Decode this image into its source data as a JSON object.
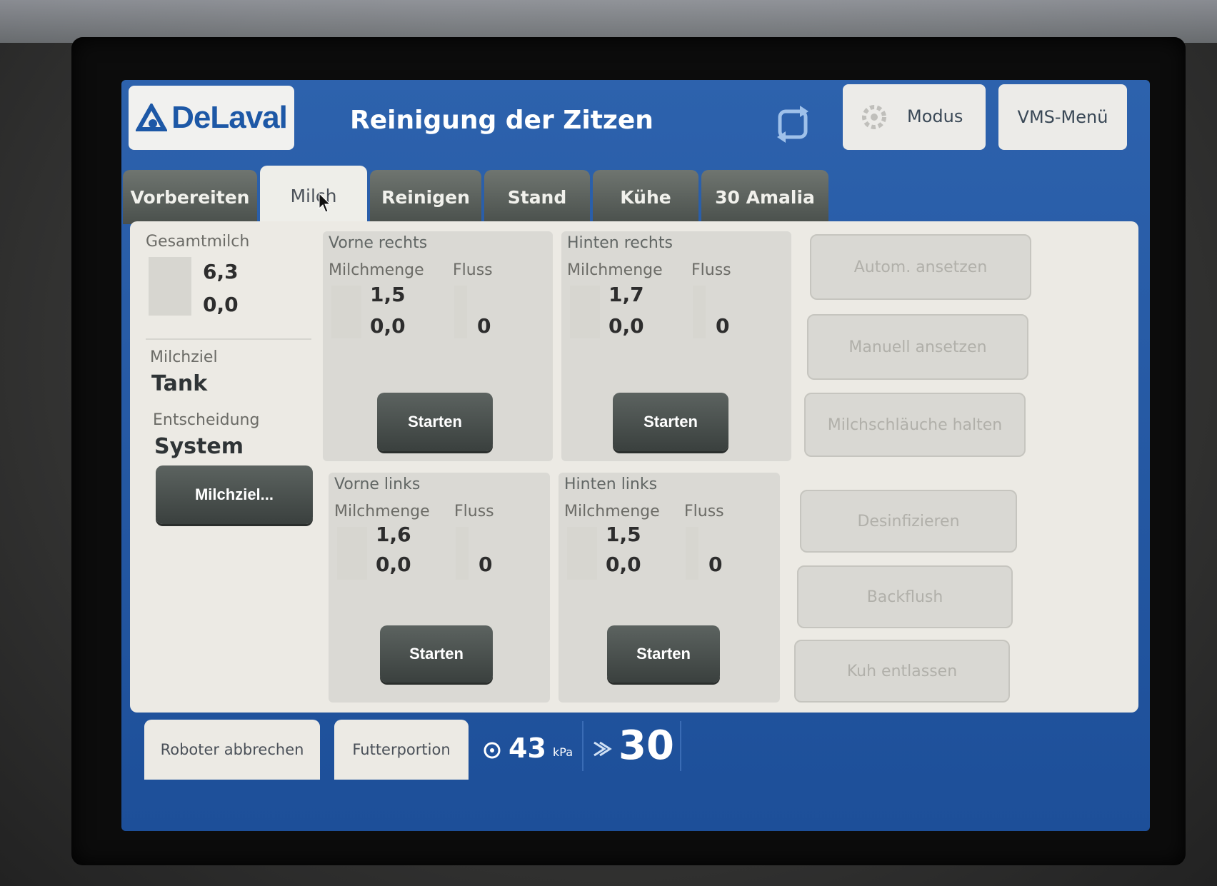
{
  "header": {
    "logo": "DeLaval",
    "title": "Reinigung der Zitzen",
    "modus_label": "Modus",
    "vms_menu_label": "VMS-Menü"
  },
  "tabs": [
    {
      "label": "Vorbereiten"
    },
    {
      "label": "Milch",
      "active": true
    },
    {
      "label": "Reinigen"
    },
    {
      "label": "Stand"
    },
    {
      "label": "Kühe"
    },
    {
      "label": "30 Amalia"
    }
  ],
  "left": {
    "gesamtmilch_label": "Gesamtmilch",
    "gesamtmilch_value1": "6,3",
    "gesamtmilch_value2": "0,0",
    "milchziel_label": "Milchziel",
    "milchziel_value": "Tank",
    "entscheidung_label": "Entscheidung",
    "entscheidung_value": "System",
    "milchziel_button": "Milchziel..."
  },
  "quarters": [
    {
      "title": "Vorne rechts",
      "menge_label": "Milchmenge",
      "fluss_label": "Fluss",
      "menge1": "1,5",
      "menge2": "0,0",
      "fluss": "0",
      "button": "Starten"
    },
    {
      "title": "Hinten rechts",
      "menge_label": "Milchmenge",
      "fluss_label": "Fluss",
      "menge1": "1,7",
      "menge2": "0,0",
      "fluss": "0",
      "button": "Starten"
    },
    {
      "title": "Vorne links",
      "menge_label": "Milchmenge",
      "fluss_label": "Fluss",
      "menge1": "1,6",
      "menge2": "0,0",
      "fluss": "0",
      "button": "Starten"
    },
    {
      "title": "Hinten links",
      "menge_label": "Milchmenge",
      "fluss_label": "Fluss",
      "menge1": "1,5",
      "menge2": "0,0",
      "fluss": "0",
      "button": "Starten"
    }
  ],
  "actions": [
    {
      "label": "Autom. ansetzen"
    },
    {
      "label": "Manuell ansetzen"
    },
    {
      "label": "Milchschläuche halten"
    },
    {
      "label": "Desinfizieren"
    },
    {
      "label": "Backflush"
    },
    {
      "label": "Kuh entlassen"
    }
  ],
  "footer": {
    "roboter_abbrechen": "Roboter abbrechen",
    "futterportion": "Futterportion",
    "vacuum_value": "43",
    "vacuum_unit": "kPa",
    "pulsation_value": "30"
  },
  "colors": {
    "brand_blue": "#1d58a6",
    "screen_blue": "#2d62ad",
    "panel": "#eceae4",
    "dark_button": "#3a403e"
  },
  "icons": [
    "sync-icon",
    "gear-icon",
    "vacuum-gauge-icon",
    "pulsation-icon",
    "cursor-arrow-icon"
  ]
}
